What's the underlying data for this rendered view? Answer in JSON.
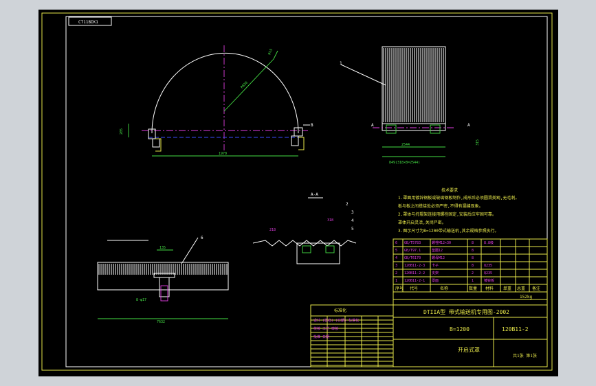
{
  "drawing": {
    "stamp": "CT11BIK1",
    "title_line": "DTIIA型 带式输送机专用图-2002",
    "model": "B=1200",
    "drawing_no": "120B11-2",
    "name": "开启式罩",
    "weight": "152kg",
    "letters": [
      "A",
      "A",
      "B"
    ]
  },
  "labels": {
    "section": "A-A",
    "dims": {
      "chord": "1970",
      "height": "205",
      "radius": "R830",
      "diameter": "φ15",
      "bottom": "2544",
      "total": "849(318×8=2544)",
      "right_h": "315",
      "detail_w": "135",
      "detail_total": "7632",
      "small1": "218",
      "small2": "318",
      "hole": "8-φ17"
    },
    "balloons": [
      "1",
      "2",
      "3",
      "4",
      "5",
      "6"
    ]
  },
  "notes": {
    "title": "技术要求",
    "lines": [
      "1.罩面用镀锌钢板或玻璃钢板制作,成形后必须圆滑美观,无毛刺。",
      "  板与板之间搭接处必须严密,不得有漏缝现象。",
      "2.罩体与托辊架连接用螺栓固定,安装后应牢固可靠。",
      "  罩体开启灵活,关闭严密。",
      "3.图示尺寸为B=1200带式输送机,其余规格参照执行。"
    ]
  },
  "bom": {
    "headers": [
      "序号",
      "代号",
      "名称",
      "数量",
      "材料",
      "单重",
      "总重",
      "备注"
    ],
    "rows": [
      [
        "6",
        "GB/T5783",
        "螺栓M12×30",
        "8",
        "8.8级",
        "",
        "",
        ""
      ],
      [
        "5",
        "GB/T97.1",
        "垫圈12",
        "8",
        "",
        "",
        "",
        ""
      ],
      [
        "4",
        "GB/T6170",
        "螺母M12",
        "8",
        "",
        "",
        "",
        ""
      ],
      [
        "3",
        "120B11-2-3",
        "卡子",
        "8",
        "Q235",
        "",
        "",
        ""
      ],
      [
        "2",
        "120B11-2-2",
        "支架",
        "2",
        "Q235",
        "",
        "",
        ""
      ],
      [
        "1",
        "120B11-2-1",
        "罩面",
        "1",
        "镀锌板",
        "",
        "",
        ""
      ]
    ]
  },
  "titleblock": {
    "left_header": "标准化",
    "left_rows": [
      "设计 (签名) (日期) 标准化",
      "校核 工艺 审核",
      "批准 日期"
    ],
    "sheet": "共1张 第1张"
  }
}
